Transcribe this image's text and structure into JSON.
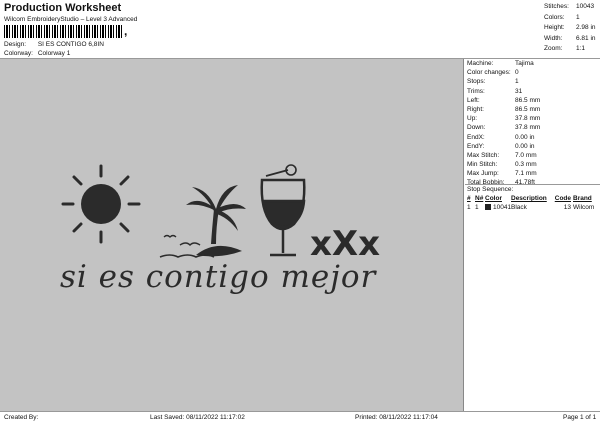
{
  "header": {
    "title": "Production Worksheet",
    "subtitle": "Wilcom EmbroideryStudio – Level 3 Advanced",
    "barcode_suffix": ",",
    "design_label": "Design:",
    "design_value": "SI ES CONTIGO 6,8IN",
    "colorway_label": "Colorway:",
    "colorway_value": "Colorway 1"
  },
  "stats": [
    {
      "label": "Stitches:",
      "value": "10043"
    },
    {
      "label": "Colors:",
      "value": "1"
    },
    {
      "label": "Height:",
      "value": "2.98 in"
    },
    {
      "label": "Width:",
      "value": "6.81 in"
    },
    {
      "label": "Zoom:",
      "value": "1:1"
    }
  ],
  "details": [
    {
      "label": "Machine:",
      "value": "Tajima"
    },
    {
      "label": "Color changes:",
      "value": "0"
    },
    {
      "label": "Stops:",
      "value": "1"
    },
    {
      "label": "Trims:",
      "value": "31"
    },
    {
      "label": "Left:",
      "value": "86.5 mm"
    },
    {
      "label": "Right:",
      "value": "86.5 mm"
    },
    {
      "label": "Up:",
      "value": "37.8 mm"
    },
    {
      "label": "Down:",
      "value": "37.8 mm"
    },
    {
      "label": "EndX:",
      "value": "0.00 in"
    },
    {
      "label": "EndY:",
      "value": "0.00 in"
    },
    {
      "label": "Max Stitch:",
      "value": "7.0 mm"
    },
    {
      "label": "Min Stitch:",
      "value": "0.3 mm"
    },
    {
      "label": "Max Jump:",
      "value": "7.1 mm"
    },
    {
      "label": "Total Bobbin:",
      "value": "41.78ft"
    }
  ],
  "stop_sequence": {
    "title": "Stop Sequence:",
    "headers": [
      "#",
      "N#",
      "Color",
      "Description",
      "Code",
      "Brand"
    ],
    "rows": [
      {
        "stop": "1",
        "needle": "1",
        "color": "10041",
        "description": "Black",
        "code": "13",
        "brand": "Wilcom",
        "swatch": "#222222"
      }
    ]
  },
  "design": {
    "script_text": "si es contigo mejor",
    "xxx_text": "xXx",
    "thread_color": "#2b2b2b",
    "background_color": "#c3c3c3"
  },
  "footer": {
    "created_by": "Created By:",
    "last_saved": "Last Saved: 08/11/2022 11:17:02",
    "printed": "Printed: 08/11/2022 11:17:04",
    "page": "Page 1 of 1"
  }
}
